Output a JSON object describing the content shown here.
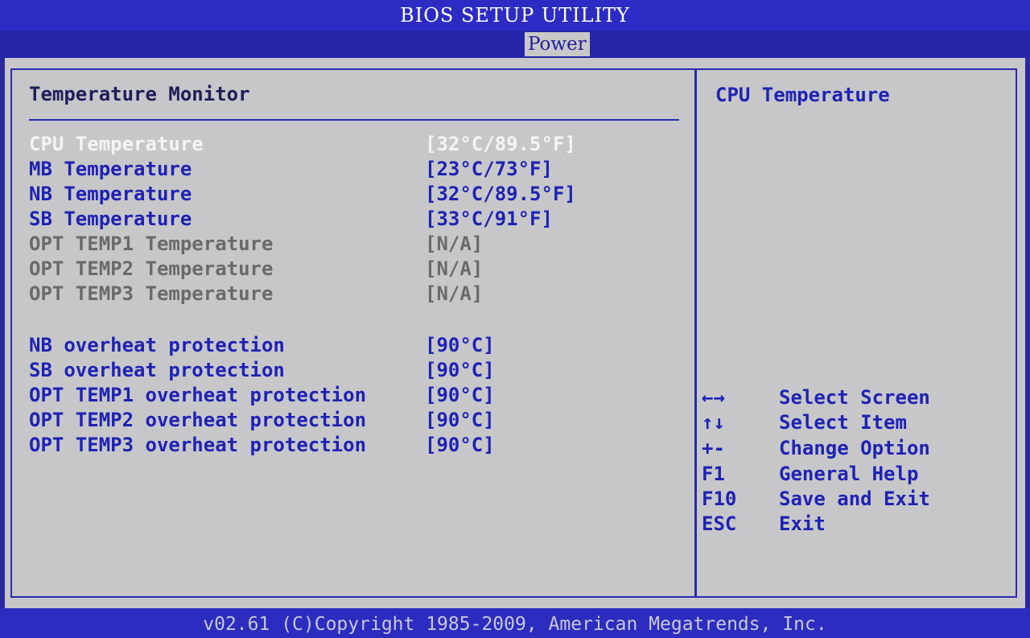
{
  "window_title": "BIOS SETUP UTILITY",
  "tabs": [
    {
      "label": "Power",
      "selected": true
    }
  ],
  "panel": {
    "section_title": "Temperature Monitor",
    "rows": [
      {
        "label": "CPU Temperature",
        "value": "[32°C/89.5°F]",
        "state": "selected"
      },
      {
        "label": "MB Temperature",
        "value": "[23°C/73°F]",
        "state": "active"
      },
      {
        "label": "NB Temperature",
        "value": "[32°C/89.5°F]",
        "state": "active"
      },
      {
        "label": "SB Temperature",
        "value": "[33°C/91°F]",
        "state": "active"
      },
      {
        "label": "OPT TEMP1 Temperature",
        "value": "[N/A]",
        "state": "disabled"
      },
      {
        "label": "OPT TEMP2 Temperature",
        "value": "[N/A]",
        "state": "disabled"
      },
      {
        "label": "OPT TEMP3 Temperature",
        "value": "[N/A]",
        "state": "disabled"
      },
      {
        "label": "NB overheat protection",
        "value": "[90°C]",
        "state": "active"
      },
      {
        "label": "SB overheat protection",
        "value": "[90°C]",
        "state": "active"
      },
      {
        "label": "OPT TEMP1 overheat protection",
        "value": "[90°C]",
        "state": "active"
      },
      {
        "label": "OPT TEMP2 overheat protection",
        "value": "[90°C]",
        "state": "active"
      },
      {
        "label": "OPT TEMP3 overheat protection",
        "value": "[90°C]",
        "state": "active"
      }
    ]
  },
  "help": {
    "title": "CPU Temperature",
    "keys": [
      {
        "key": "←→",
        "desc": "Select Screen"
      },
      {
        "key": "↑↓",
        "desc": "Select Item"
      },
      {
        "key": "+-",
        "desc": "Change Option"
      },
      {
        "key": "F1",
        "desc": "General Help"
      },
      {
        "key": "F10",
        "desc": "Save and Exit"
      },
      {
        "key": "ESC",
        "desc": "Exit"
      }
    ]
  },
  "footer": "v02.61 (C)Copyright 1985-2009, American Megatrends, Inc.",
  "colors": {
    "bios_blue": "#2c2cc4",
    "panel_grey": "#c7c7c9",
    "item_blue": "#1e22b4",
    "item_selected": "#f4f4f4",
    "item_disabled": "#6a6a6c"
  }
}
